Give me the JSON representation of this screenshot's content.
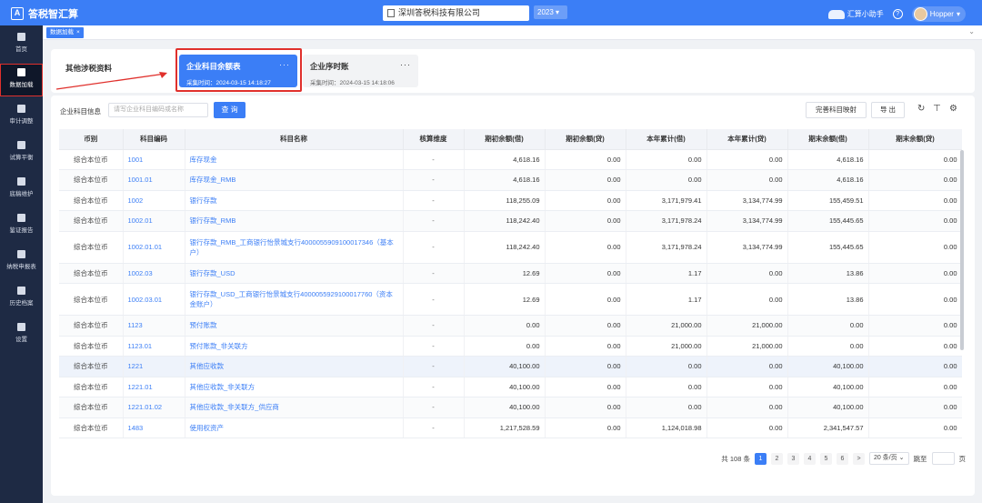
{
  "app": {
    "title": "答税智汇算",
    "logo_glyph": "A"
  },
  "header": {
    "company": "深圳答税科技有限公司",
    "year": "2023",
    "assistant": "汇算小助手",
    "help_glyph": "?",
    "user": "Hopper"
  },
  "sidebar": {
    "items": [
      {
        "label": "首页",
        "icon": "home-icon"
      },
      {
        "label": "数据加载",
        "icon": "database-icon"
      },
      {
        "label": "审计调整",
        "icon": "adjust-icon"
      },
      {
        "label": "试算平衡",
        "icon": "balance-icon"
      },
      {
        "label": "底稿维护",
        "icon": "file-icon"
      },
      {
        "label": "鉴证报告",
        "icon": "check-icon"
      },
      {
        "label": "纳税申报表",
        "icon": "monitor-icon"
      },
      {
        "label": "历史档案",
        "icon": "folder-icon"
      },
      {
        "label": "设置",
        "icon": "gear-icon"
      }
    ]
  },
  "tabs": [
    {
      "label": "数据加载",
      "close": "×"
    }
  ],
  "tab_collapse": "⌄",
  "cards": {
    "other_label": "其他涉税资料",
    "active": {
      "title": "企业科目余额表",
      "time": "采集时间：2024-03-15 14:18:27",
      "more": "···"
    },
    "inactive": {
      "title": "企业序时账",
      "time": "采集时间：2024-03-15 14:18:06",
      "more": "···"
    }
  },
  "filter": {
    "label": "企业科目信息",
    "placeholder": "请写企业科目编码或名称",
    "query_label": "查 询",
    "mapping_label": "完善科目映射",
    "export_label": "导 出"
  },
  "table": {
    "columns": [
      "币别",
      "科目编码",
      "科目名称",
      "核算维度",
      "期初余额(借)",
      "期初余额(贷)",
      "本年累计(借)",
      "本年累计(贷)",
      "期末余额(借)",
      "期末余额(贷)"
    ],
    "rows": [
      [
        "综合本位币",
        "1001",
        "库存现金",
        "-",
        "4,618.16",
        "0.00",
        "0.00",
        "0.00",
        "4,618.16",
        "0.00"
      ],
      [
        "综合本位币",
        "1001.01",
        "库存现金_RMB",
        "-",
        "4,618.16",
        "0.00",
        "0.00",
        "0.00",
        "4,618.16",
        "0.00"
      ],
      [
        "综合本位币",
        "1002",
        "银行存款",
        "-",
        "118,255.09",
        "0.00",
        "3,171,979.41",
        "3,134,774.99",
        "155,459.51",
        "0.00"
      ],
      [
        "综合本位币",
        "1002.01",
        "银行存款_RMB",
        "-",
        "118,242.40",
        "0.00",
        "3,171,978.24",
        "3,134,774.99",
        "155,445.65",
        "0.00"
      ],
      [
        "综合本位币",
        "1002.01.01",
        "银行存款_RMB_工商银行怡景城支行4000055909100017346（基本户）",
        "-",
        "118,242.40",
        "0.00",
        "3,171,978.24",
        "3,134,774.99",
        "155,445.65",
        "0.00"
      ],
      [
        "综合本位币",
        "1002.03",
        "银行存款_USD",
        "-",
        "12.69",
        "0.00",
        "1.17",
        "0.00",
        "13.86",
        "0.00"
      ],
      [
        "综合本位币",
        "1002.03.01",
        "银行存款_USD_工商银行怡景城支行4000055929100017760（资本金账户）",
        "-",
        "12.69",
        "0.00",
        "1.17",
        "0.00",
        "13.86",
        "0.00"
      ],
      [
        "综合本位币",
        "1123",
        "预付账款",
        "-",
        "0.00",
        "0.00",
        "21,000.00",
        "21,000.00",
        "0.00",
        "0.00"
      ],
      [
        "综合本位币",
        "1123.01",
        "预付账款_非关联方",
        "-",
        "0.00",
        "0.00",
        "21,000.00",
        "21,000.00",
        "0.00",
        "0.00"
      ],
      [
        "综合本位币",
        "1221",
        "其他应收款",
        "-",
        "40,100.00",
        "0.00",
        "0.00",
        "0.00",
        "40,100.00",
        "0.00"
      ],
      [
        "综合本位币",
        "1221.01",
        "其他应收款_非关联方",
        "-",
        "40,100.00",
        "0.00",
        "0.00",
        "0.00",
        "40,100.00",
        "0.00"
      ],
      [
        "综合本位币",
        "1221.01.02",
        "其他应收款_非关联方_供应商",
        "-",
        "40,100.00",
        "0.00",
        "0.00",
        "0.00",
        "40,100.00",
        "0.00"
      ],
      [
        "综合本位币",
        "1483",
        "使用权资产",
        "-",
        "1,217,528.59",
        "0.00",
        "1,124,018.98",
        "0.00",
        "2,341,547.57",
        "0.00"
      ]
    ]
  },
  "pagination": {
    "total": "共 108 条",
    "pages": [
      "1",
      "2",
      "3",
      "4",
      "5",
      "6"
    ],
    "current": "1",
    "next": ">",
    "page_size": "20 条/页",
    "jump_label": "跳至",
    "page_unit": "页"
  },
  "colors": {
    "accent": "#3b7ef6",
    "sidebar": "#1e2a44",
    "highlight": "#e0302c"
  }
}
